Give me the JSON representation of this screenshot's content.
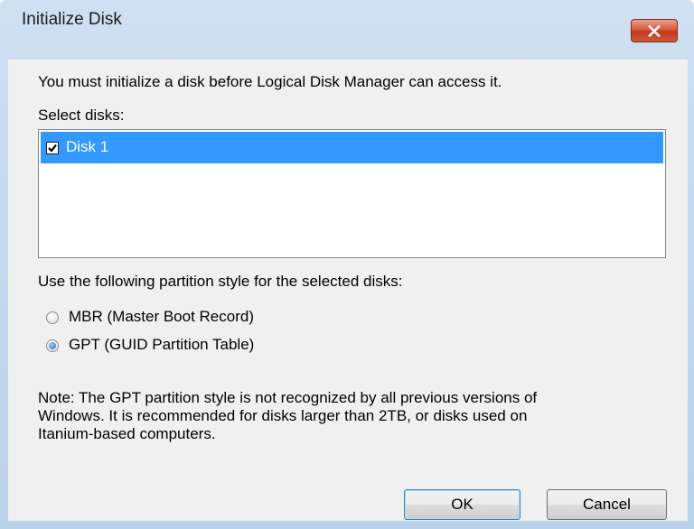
{
  "window": {
    "title": "Initialize Disk",
    "close_icon": "close-icon"
  },
  "intro_text": "You must initialize a disk before Logical Disk Manager can access it.",
  "select_label": "Select disks:",
  "disks": [
    {
      "label": "Disk 1",
      "checked": true,
      "selected": true
    }
  ],
  "partition_label": "Use the following partition style for the selected disks:",
  "partition_options": [
    {
      "label": "MBR (Master Boot Record)",
      "selected": false
    },
    {
      "label": "GPT (GUID Partition Table)",
      "selected": true
    }
  ],
  "note": {
    "line1": "Note: The GPT partition style is not recognized by all previous versions of",
    "line2": "Windows. It is recommended for disks larger than 2TB, or disks used on",
    "line3": "Itanium-based computers."
  },
  "buttons": {
    "ok": "OK",
    "cancel": "Cancel"
  },
  "colors": {
    "selection": "#3399ff",
    "close_button": "#c5381b",
    "dialog_bg": "#f0f0f0",
    "frame": "#b9d1ea"
  }
}
